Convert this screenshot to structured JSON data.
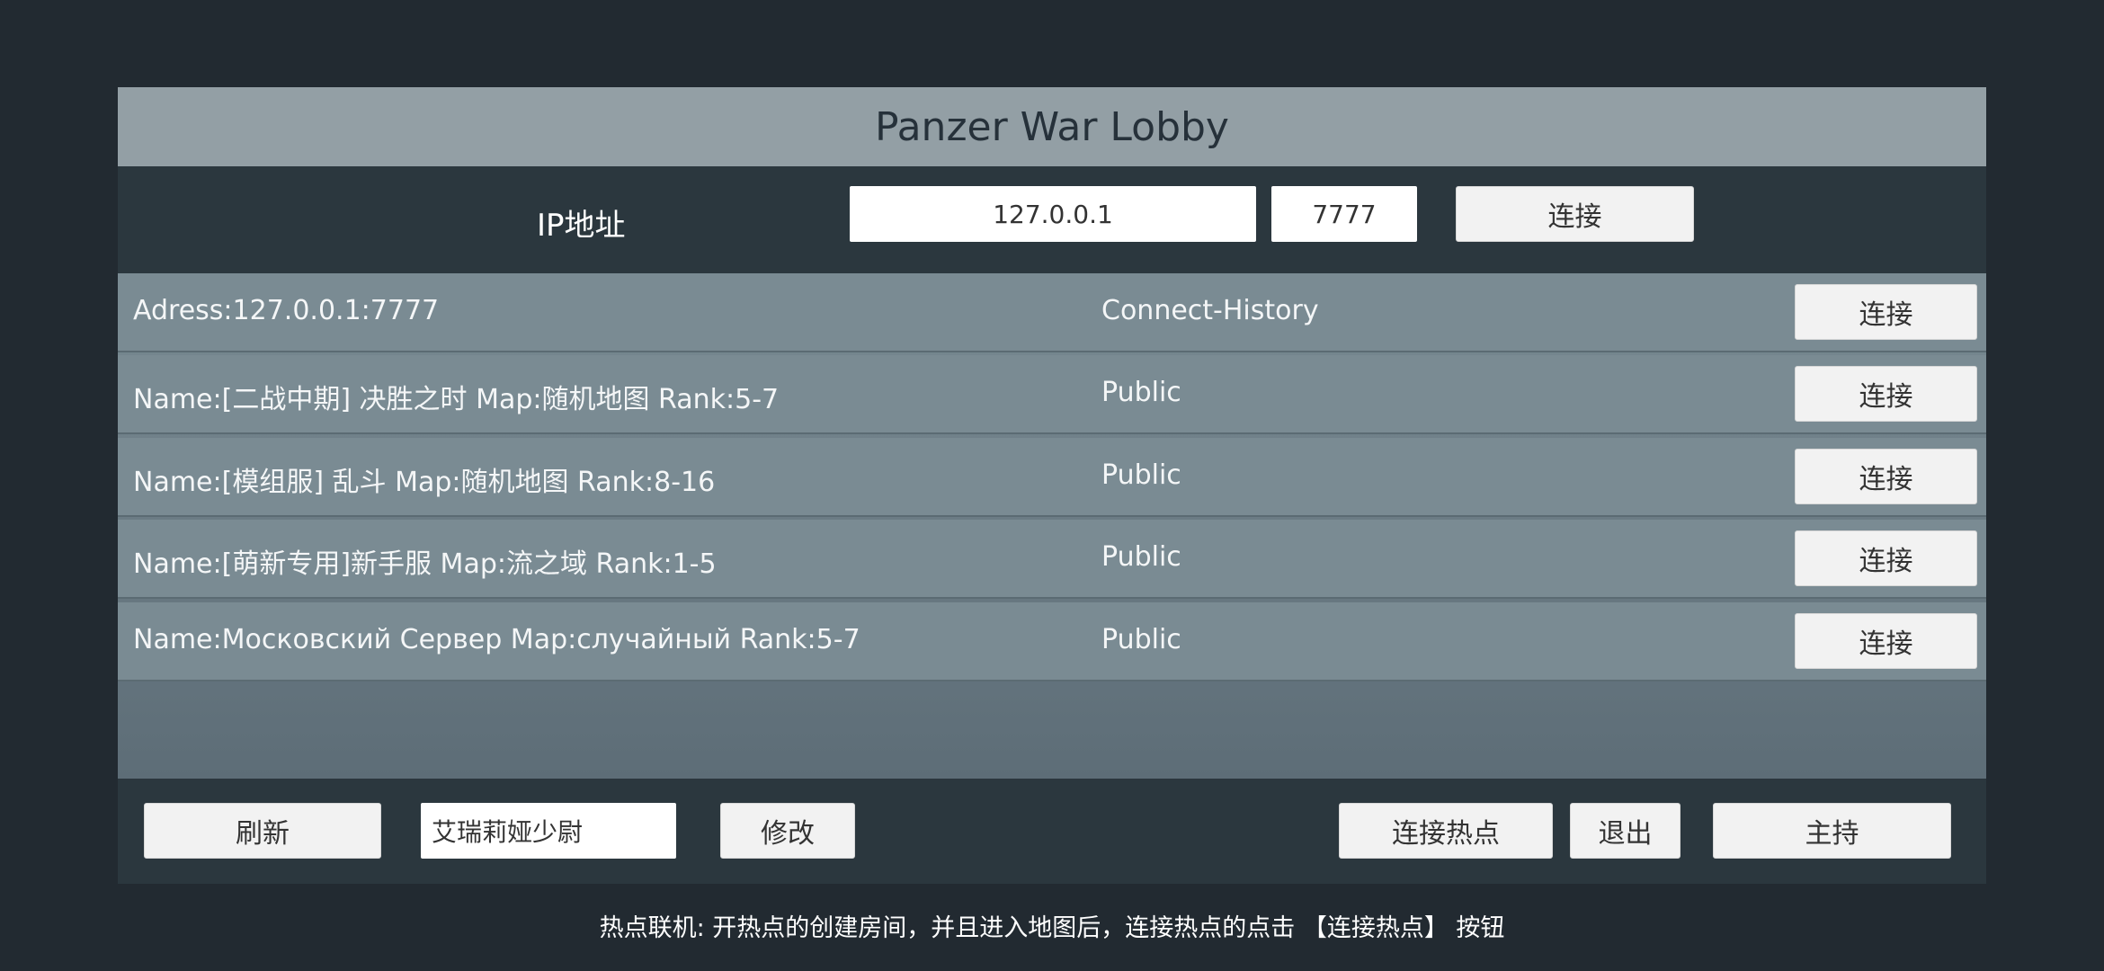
{
  "lobby": {
    "title": "Panzer War Lobby",
    "ip_label": "IP地址",
    "ip_value": "127.0.0.1",
    "port_value": "7777",
    "connect_label": "连接"
  },
  "servers": [
    {
      "name": "Adress:127.0.0.1:7777",
      "type": "Connect-History",
      "button": "连接"
    },
    {
      "name": "Name:[二战中期] 决胜之时 Map:随机地图 Rank:5-7",
      "type": "Public",
      "button": "连接"
    },
    {
      "name": "Name:[模组服] 乱斗 Map:随机地图 Rank:8-16",
      "type": "Public",
      "button": "连接"
    },
    {
      "name": "Name:[萌新专用]新手服 Map:流之域 Rank:1-5",
      "type": "Public",
      "button": "连接"
    },
    {
      "name": "Name:Московский Сервер Map:случайный Rank:5-7",
      "type": "Public",
      "button": "连接"
    }
  ],
  "bottom": {
    "refresh_label": "刷新",
    "player_name": "艾瑞莉娅少尉",
    "modify_label": "修改",
    "hotspot_label": "连接热点",
    "exit_label": "退出",
    "host_label": "主持"
  },
  "hint": "热点联机: 开热点的创建房间，并且进入地图后，连接热点的点击 【连接热点】 按钮"
}
